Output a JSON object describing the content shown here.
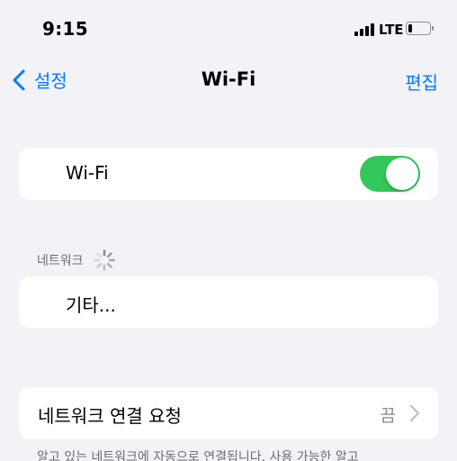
{
  "status_bar": {
    "time": "9:15",
    "network_type": "LTE",
    "battery_level": 0.2,
    "signal_bars": 4
  },
  "nav": {
    "back_label": "설정",
    "title": "Wi-Fi",
    "edit_label": "편집"
  },
  "wifi": {
    "label": "Wi-Fi",
    "enabled": true,
    "toggle_color": "#34c759"
  },
  "networks": {
    "header": "네트워크",
    "other_label": "기타..."
  },
  "ask_to_join": {
    "label": "네트워크 연결 요청",
    "value": "끔"
  },
  "footer": {
    "note": "알고 있는 네트워크에 자동으로 연결됩니다. 사용 가능한 알고"
  },
  "colors": {
    "accent": "#007aff",
    "background": "#f2f2f7",
    "secondary_text": "#6d6d72"
  },
  "icons": [
    "chevron-left-icon",
    "loading-spinner-icon",
    "chevron-right-icon",
    "signal-icon",
    "battery-icon"
  ]
}
